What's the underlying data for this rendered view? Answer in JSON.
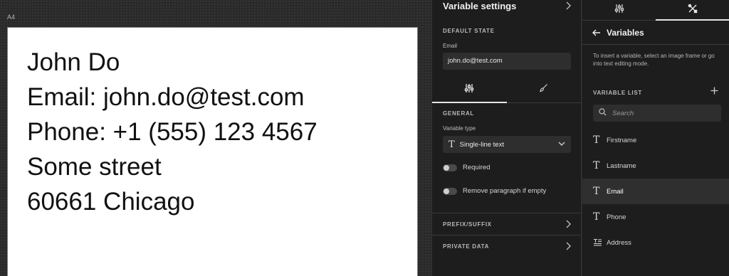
{
  "canvas": {
    "page_label": "A4",
    "lines": [
      "John Do",
      "Email: john.do@test.com",
      "Phone: +1 (555) 123 4567",
      "Some street",
      "60661 Chicago"
    ]
  },
  "settings": {
    "title": "Variable settings",
    "default_state_label": "DEFAULT STATE",
    "email_label": "Email",
    "email_value": "john.do@test.com",
    "tabs": [
      {
        "icon": "sliders-icon"
      },
      {
        "icon": "brush-icon"
      }
    ],
    "general_label": "GENERAL",
    "variable_type_label": "Variable type",
    "variable_type_value": "Single-line text",
    "required_label": "Required",
    "remove_paragraph_label": "Remove paragraph if empty",
    "prefix_suffix_label": "PREFIX/SUFFIX",
    "private_data_label": "PRIVATE DATA"
  },
  "right_panel": {
    "tabs": [
      {
        "icon": "sliders-icon"
      },
      {
        "icon": "tools-icon"
      }
    ],
    "title": "Variables",
    "hint": "To insert a variable, select an image frame or go into text editing mode.",
    "variable_list_label": "VARIABLE LIST",
    "search_placeholder": "Search",
    "variables": [
      {
        "name": "Firstname",
        "icon": "text-type-icon"
      },
      {
        "name": "Lastname",
        "icon": "text-type-icon"
      },
      {
        "name": "Email",
        "icon": "text-type-icon"
      },
      {
        "name": "Phone",
        "icon": "text-type-icon"
      },
      {
        "name": "Address",
        "icon": "multiline-text-icon"
      }
    ],
    "selected_variable": "Email"
  }
}
